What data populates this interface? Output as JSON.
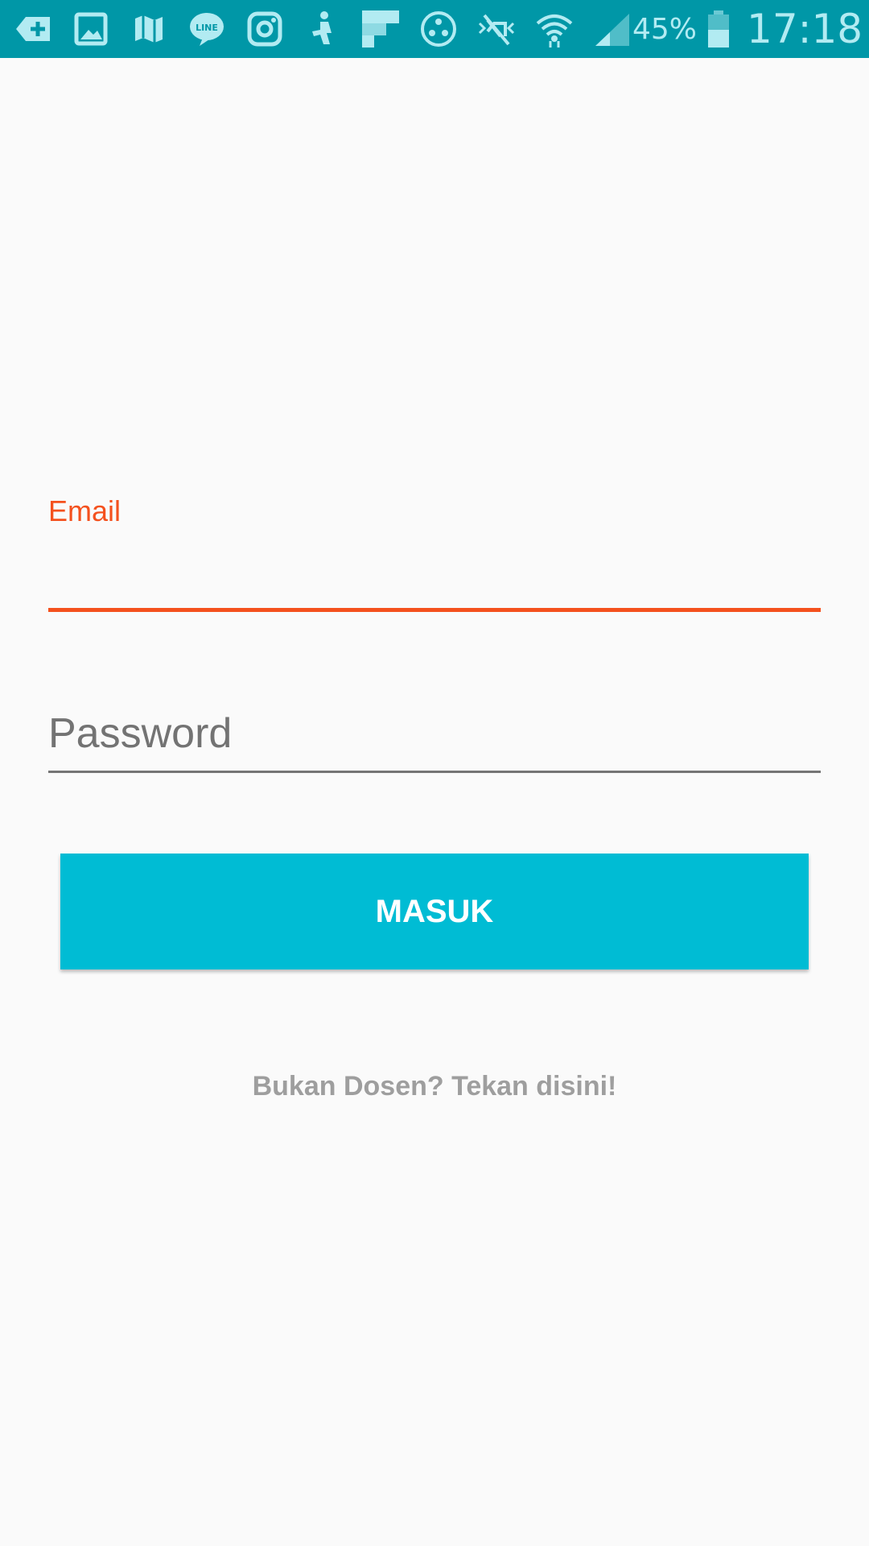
{
  "status_bar": {
    "icons": [
      "download-box-icon",
      "gallery-icon",
      "map-icon",
      "line-app-icon",
      "instagram-icon",
      "fitness-app-icon",
      "flipboard-icon",
      "share-dots-icon",
      "mute-icon",
      "wifi-icon",
      "signal-icon",
      "battery-icon"
    ],
    "battery_percent": "45%",
    "time": "17:18",
    "colors": {
      "background": "#0097a7",
      "foreground": "#b2ebf2"
    }
  },
  "form": {
    "email_label": "Email",
    "email_value": "",
    "password_placeholder": "Password",
    "password_value": "",
    "submit_label": "MASUK",
    "switch_link": "Bukan Dosen? Tekan disini!"
  },
  "colors": {
    "accent": "#f4511e",
    "button": "#00bcd4",
    "link": "#9e9e9e"
  }
}
